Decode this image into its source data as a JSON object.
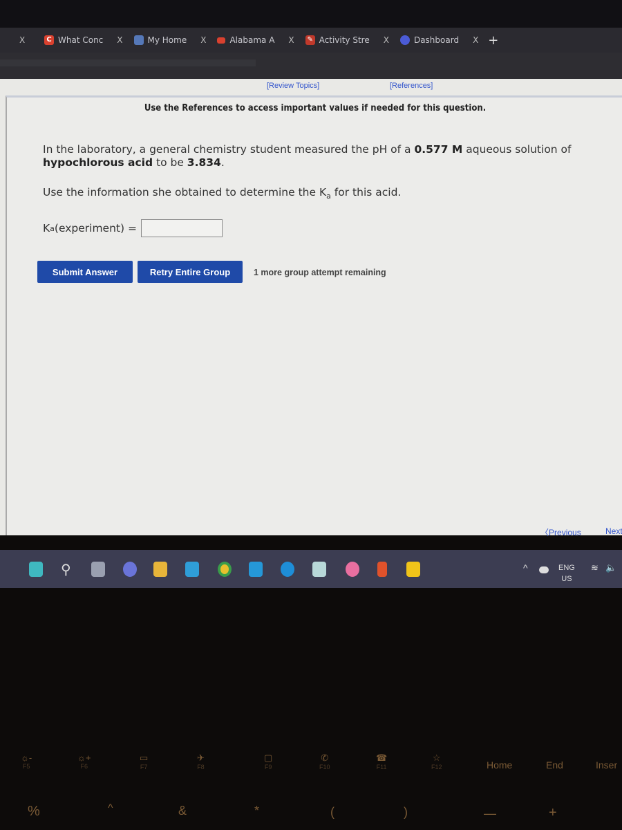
{
  "browser": {
    "tabs": [
      {
        "label": "What Conc",
        "icon": "c-logo-icon",
        "color": "#d9412f"
      },
      {
        "label": "My Home",
        "icon": "dots-logo-icon",
        "color": "#5578b8"
      },
      {
        "label": "Alabama A",
        "icon": "folder-icon",
        "color": "#d9412f"
      },
      {
        "label": "Activity Stre",
        "icon": "pencil-icon",
        "color": "#c0392b"
      },
      {
        "label": "Dashboard",
        "icon": "dashboard-icon",
        "color": "#4b5bd6"
      }
    ],
    "close_glyph": "X",
    "new_tab_glyph": "+"
  },
  "page": {
    "review_topics": "[Review Topics]",
    "references": "[References]",
    "note": "Use the References to access important values if needed for this question.",
    "question": {
      "p1_a": "In the laboratory, a general chemistry student measured the pH of a ",
      "concentration": "0.577 M",
      "p1_b": " aqueous solution of ",
      "acid": "hypochlorous acid",
      "p1_c": " to be ",
      "ph": "3.834",
      "p1_d": ".",
      "p2_a": "Use the information she obtained to determine the K",
      "p2_sub": "a",
      "p2_b": " for this acid."
    },
    "answer": {
      "label_k": "K",
      "label_sub": "a",
      "label_rest": "(experiment) =",
      "value": ""
    },
    "submit_label": "Submit Answer",
    "retry_label": "Retry Entire Group",
    "attempts": "1 more group attempt remaining",
    "previous": "Previous",
    "next": "Next"
  },
  "taskbar": {
    "apps": [
      "windows-start-icon",
      "search-icon",
      "task-view-icon",
      "chat-icon",
      "file-explorer-icon",
      "mail-icon",
      "chrome-icon",
      "lens-icon",
      "edge-icon",
      "photos-icon",
      "itunes-icon",
      "office-icon",
      "sticky-notes-icon"
    ],
    "language": "ENG",
    "region": "US"
  },
  "keyboard": {
    "fkeys": [
      {
        "symbol": "☼-",
        "label": "F5"
      },
      {
        "symbol": "☼+",
        "label": "F6"
      },
      {
        "symbol": "▭",
        "label": "F7"
      },
      {
        "symbol": "✈",
        "label": "F8"
      },
      {
        "symbol": "▢",
        "label": "F9"
      },
      {
        "symbol": "✆",
        "label": "F10"
      },
      {
        "symbol": "☎",
        "label": "F11"
      },
      {
        "symbol": "☆",
        "label": "F12"
      }
    ],
    "home": "Home",
    "end": "End",
    "insert": "Inser",
    "row2": [
      "%",
      "^",
      "&",
      "*",
      "(",
      ")",
      "—",
      "+"
    ]
  }
}
